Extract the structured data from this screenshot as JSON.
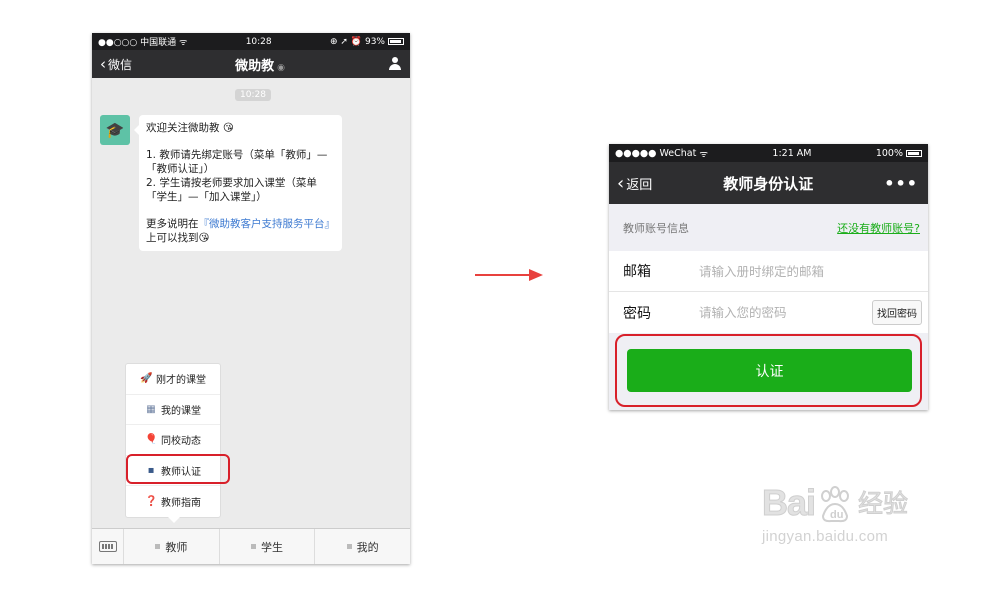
{
  "phone1": {
    "status": {
      "carrier": "●●○○○ 中国联通",
      "wifi": "ᯤ",
      "time": "10:28",
      "indicators": "⊕ ➚ ⏰",
      "battery": "93%"
    },
    "nav": {
      "back_label": "微信",
      "title": "微助教",
      "title_icon": "ear-icon"
    },
    "chat": {
      "timestamp": "10:28",
      "message": {
        "greeting": "欢迎关注微助教 😘",
        "line1": "1. 教师请先绑定账号（菜单「教师」—「教师认证」）",
        "line2": "2. 学生请按老师要求加入课堂（菜单「学生」—「加入课堂」）",
        "more_prefix": "更多说明在",
        "more_link": "『微助教客户支持服务平台』",
        "more_suffix": "上可以找到😘"
      }
    },
    "popup_menu": {
      "items": [
        {
          "icon": "🚀",
          "label": "刚才的课堂"
        },
        {
          "icon": "▦",
          "label": "我的课堂"
        },
        {
          "icon": "🎈",
          "label": "同校动态"
        },
        {
          "icon": "▪",
          "label": "教师认证"
        },
        {
          "icon": "❓",
          "label": "教师指南"
        }
      ]
    },
    "bottom_bar": {
      "tabs": [
        "教师",
        "学生",
        "我的"
      ]
    }
  },
  "phone2": {
    "status": {
      "carrier": "●●●●● WeChat",
      "wifi": "ᯤ",
      "time": "1:21 AM",
      "battery": "100%"
    },
    "nav": {
      "back_label": "返回",
      "title": "教师身份认证",
      "more": "•••"
    },
    "section": {
      "title": "教师账号信息",
      "link": "还没有教师账号?"
    },
    "form": {
      "email_label": "邮箱",
      "email_placeholder": "请输入册时绑定的邮箱",
      "password_label": "密码",
      "password_placeholder": "请输入您的密码",
      "find_password": "找回密码"
    },
    "submit_label": "认证"
  },
  "watermark": {
    "brand": "Bai",
    "brand_suffix": "经验",
    "url": "jingyan.baidu.com"
  },
  "colors": {
    "accent_green": "#1aad19",
    "highlight_red": "#d8202a",
    "arrow_red": "#e8413e",
    "link_blue": "#3d7ad1"
  }
}
